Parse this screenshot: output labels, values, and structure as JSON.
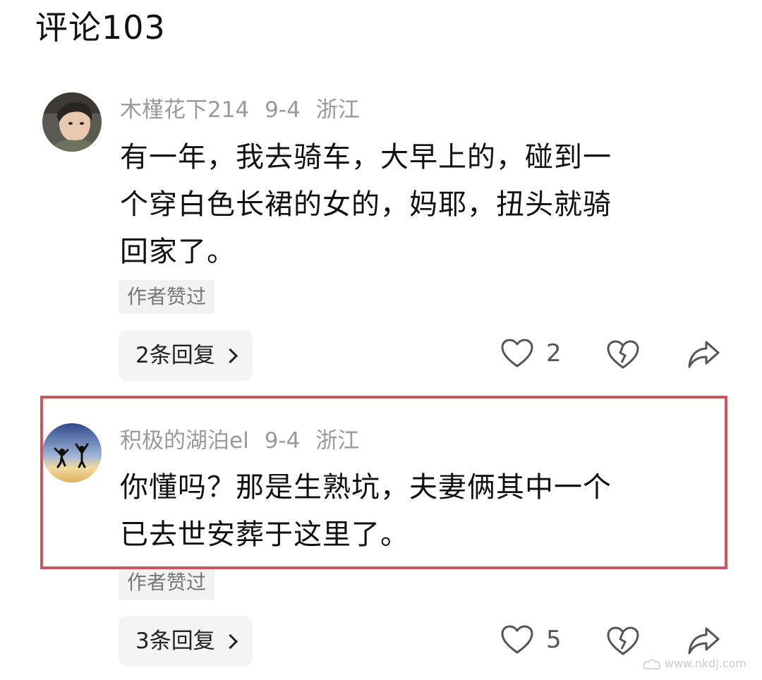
{
  "header": {
    "title": "评论103"
  },
  "comments": [
    {
      "username": "木槿花下214",
      "date": "9-4",
      "location": "浙江",
      "lines": [
        "有一年，我去骑车，大早上的，碰到一",
        "个穿白色长裙的女的，妈耶，扭头就骑",
        "回家了。"
      ],
      "badge": "作者赞过",
      "replies_label": "2条回复",
      "likes": "2"
    },
    {
      "username": "积极的湖泊el",
      "date": "9-4",
      "location": "浙江",
      "lines": [
        "你懂吗？那是生熟坑，夫妻俩其中一个",
        "已去世安葬于这里了。"
      ],
      "badge": "作者赞过",
      "replies_label": "3条回复",
      "likes": "5"
    }
  ],
  "watermark": {
    "text": "www.nkdj.com"
  },
  "colors": {
    "highlight": "#c9575f",
    "meta": "#9a9a9a"
  }
}
